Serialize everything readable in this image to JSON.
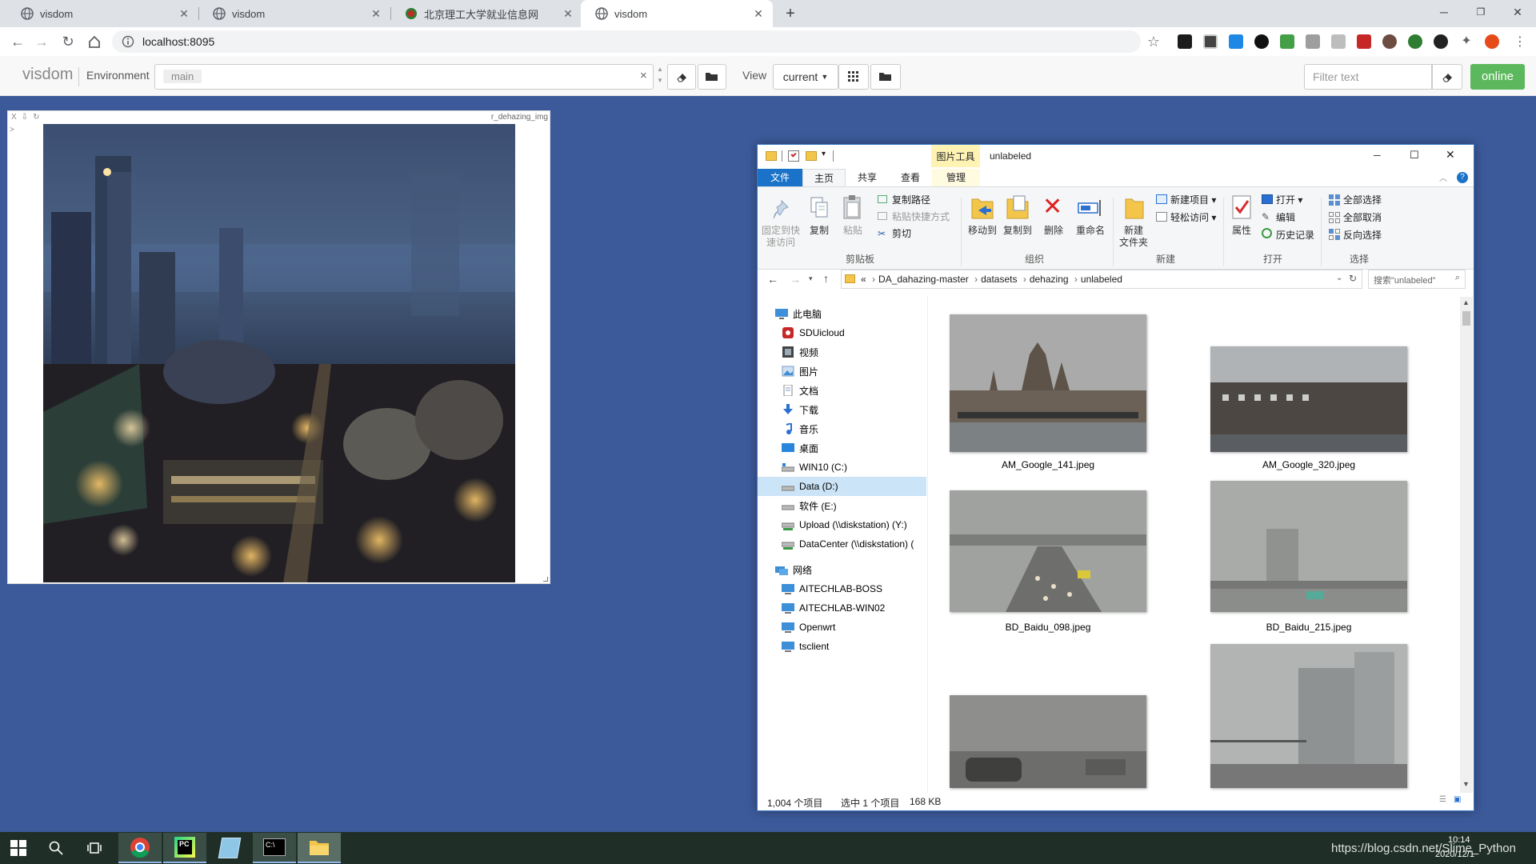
{
  "browser": {
    "tabs": [
      {
        "title": "visdom",
        "icon": "globe-icon"
      },
      {
        "title": "visdom",
        "icon": "globe-icon"
      },
      {
        "title": "北京理工大学就业信息网",
        "icon": "bit-logo-icon"
      },
      {
        "title": "visdom",
        "icon": "globe-icon",
        "active": true
      }
    ],
    "new_tab": "+",
    "url": "localhost:8095"
  },
  "visdom": {
    "brand": "visdom",
    "environment_label": "Environment",
    "environment_value": "main",
    "clear_x": "×",
    "view_label": "View",
    "view_value": "current",
    "filter_placeholder": "Filter text",
    "online_label": "online",
    "pane": {
      "title": "r_dehazing_img",
      "controls": [
        "X",
        "⇩",
        "↻"
      ],
      "caret": ">"
    }
  },
  "explorer": {
    "context_tab": "图片工具",
    "folder_title": "unlabeled",
    "ribbon_tabs": [
      "文件",
      "主页",
      "共享",
      "查看",
      "管理"
    ],
    "clipboard": {
      "pin": "固定到快\n速访问",
      "copy": "复制",
      "paste": "粘贴",
      "copy_path": "复制路径",
      "paste_shortcut": "粘贴快捷方式",
      "cut": "剪切",
      "group": "剪贴板"
    },
    "organize": {
      "move_to": "移动到",
      "copy_to": "复制到",
      "delete": "删除",
      "rename": "重命名",
      "group": "组织"
    },
    "new": {
      "new_folder": "新建\n文件夹",
      "new_item": "新建项目",
      "easy_access": "轻松访问",
      "group": "新建"
    },
    "open": {
      "properties": "属性",
      "open": "打开",
      "edit": "编辑",
      "history": "历史记录",
      "group": "打开"
    },
    "select": {
      "select_all": "全部选择",
      "select_none": "全部取消",
      "invert": "反向选择",
      "group": "选择"
    },
    "breadcrumb": [
      "«",
      "DA_dahazing-master",
      "datasets",
      "dehazing",
      "unlabeled"
    ],
    "search_placeholder": "搜索\"unlabeled\"",
    "nav": [
      {
        "label": "此电脑",
        "level": 0,
        "icon": "computer-icon"
      },
      {
        "label": "SDUicloud",
        "level": 1,
        "icon": "cloud-app-icon"
      },
      {
        "label": "视频",
        "level": 1,
        "icon": "video-folder-icon"
      },
      {
        "label": "图片",
        "level": 1,
        "icon": "pictures-folder-icon"
      },
      {
        "label": "文档",
        "level": 1,
        "icon": "documents-folder-icon"
      },
      {
        "label": "下载",
        "level": 1,
        "icon": "download-icon"
      },
      {
        "label": "音乐",
        "level": 1,
        "icon": "music-icon"
      },
      {
        "label": "桌面",
        "level": 1,
        "icon": "desktop-icon"
      },
      {
        "label": "WIN10 (C:)",
        "level": 1,
        "icon": "system-drive-icon"
      },
      {
        "label": "Data (D:)",
        "level": 1,
        "icon": "drive-icon",
        "selected": true
      },
      {
        "label": "软件 (E:)",
        "level": 1,
        "icon": "drive-icon"
      },
      {
        "label": "Upload (\\\\diskstation) (Y:)",
        "level": 1,
        "icon": "network-drive-icon"
      },
      {
        "label": "DataCenter (\\\\diskstation) (",
        "level": 1,
        "icon": "network-drive-icon"
      },
      {
        "label": "网络",
        "level": 0,
        "icon": "network-icon"
      },
      {
        "label": "AITECHLAB-BOSS",
        "level": 1,
        "icon": "monitor-icon"
      },
      {
        "label": "AITECHLAB-WIN02",
        "level": 1,
        "icon": "monitor-icon"
      },
      {
        "label": "Openwrt",
        "level": 1,
        "icon": "monitor-icon"
      },
      {
        "label": "tsclient",
        "level": 1,
        "icon": "monitor-icon"
      }
    ],
    "files": [
      {
        "name": "AM_Google_141.jpeg"
      },
      {
        "name": "AM_Google_320.jpeg"
      },
      {
        "name": "BD_Baidu_098.jpeg"
      },
      {
        "name": "BD_Baidu_215.jpeg"
      },
      {
        "name": ""
      },
      {
        "name": ""
      }
    ],
    "status": {
      "count": "1,004 个项目",
      "selected": "选中 1 个项目",
      "size": "168 KB"
    }
  },
  "taskbar": {
    "time": "10:14",
    "date": "2020/12/1",
    "watermark": "https://blog.csdn.net/Slime_Python"
  }
}
